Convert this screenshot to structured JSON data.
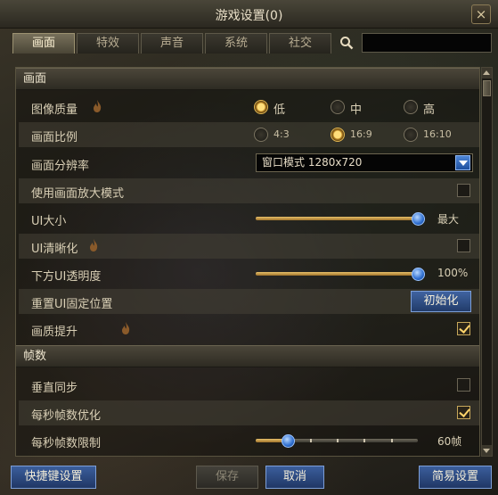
{
  "window": {
    "title": "游戏设置(0)",
    "close_label": "×"
  },
  "tabs": [
    {
      "label": "画面",
      "active": true
    },
    {
      "label": "特效",
      "active": false
    },
    {
      "label": "声音",
      "active": false
    },
    {
      "label": "系统",
      "active": false
    },
    {
      "label": "社交",
      "active": false
    }
  ],
  "search": {
    "icon": "search-icon",
    "value": ""
  },
  "sections": {
    "display": "画面",
    "framerate": "帧数"
  },
  "settings": {
    "image_quality": {
      "label": "图像质量",
      "options": [
        "低",
        "中",
        "高"
      ],
      "selected": "低"
    },
    "aspect_ratio": {
      "label": "画面比例",
      "options": [
        "4:3",
        "16:9",
        "16:10"
      ],
      "selected": "16:9"
    },
    "resolution": {
      "label": "画面分辨率",
      "value": "窗口模式 1280x720"
    },
    "magnify_mode": {
      "label": "使用画面放大模式",
      "checked": false
    },
    "ui_size": {
      "label": "UI大小",
      "value_text": "最大",
      "level": 1.0
    },
    "ui_sharpen": {
      "label": "UI清晰化",
      "checked": false
    },
    "bottom_ui_opacity": {
      "label": "下方UI透明度",
      "value_text": "100%",
      "level": 1.0
    },
    "reset_ui": {
      "label": "重置UI固定位置",
      "button": "初始化"
    },
    "quality_boost": {
      "label": "画质提升",
      "checked": true
    },
    "vsync": {
      "label": "垂直同步",
      "checked": false
    },
    "fps_optimize": {
      "label": "每秒帧数优化",
      "checked": true
    },
    "fps_limit": {
      "label": "每秒帧数限制",
      "value_text": "60帧",
      "level": 0.2
    }
  },
  "footer": {
    "shortcut": "快捷键设置",
    "save": "保存",
    "cancel": "取消",
    "simple": "简易设置"
  },
  "colors": {
    "accent_gold": "#e2b650",
    "button_blue": "#2f5190",
    "slider_thumb": "#2f6fd0"
  }
}
